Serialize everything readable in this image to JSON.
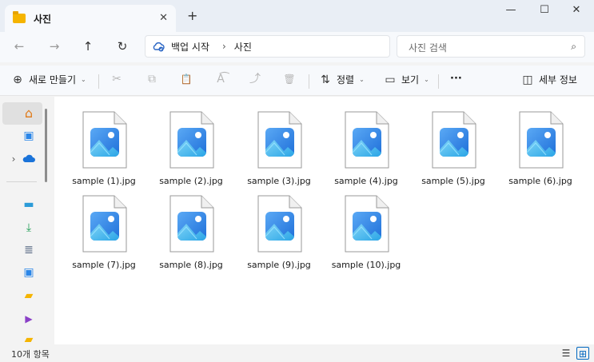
{
  "window": {
    "tab_title": "사진",
    "tab_close": "✕",
    "new_tab": "+",
    "minimize": "—",
    "maximize": "☐",
    "close": "✕"
  },
  "nav": {
    "back": "←",
    "forward": "→",
    "up": "↑",
    "refresh": "↻",
    "breadcrumb": [
      "백업 시작",
      "사진"
    ],
    "breadcrumb_sep": "›",
    "search_placeholder": "사진 검색",
    "search_icon": "⌕"
  },
  "commands": {
    "new": "새로 만들기",
    "sort": "정렬",
    "view": "보기",
    "more": "···",
    "details": "세부 정보",
    "dropdown": "⌄"
  },
  "icons": {
    "plus_circle": "⊕",
    "cut": "✂",
    "copy": "⧉",
    "paste": "📋",
    "rename": "A͡",
    "share": "⤴",
    "delete": "🗑",
    "sort": "⇅",
    "view": "▭",
    "details": "◫",
    "home": "⌂",
    "gallery": "▣",
    "expand": "›",
    "desktop": "▬",
    "downloads": "⤓",
    "documents": "≣",
    "pictures": "▣",
    "folder": "▰",
    "videos": "▶",
    "list_view": "☰",
    "grid_view": "⊞"
  },
  "files": [
    "sample (1).jpg",
    "sample (2).jpg",
    "sample (3).jpg",
    "sample (4).jpg",
    "sample (5).jpg",
    "sample (6).jpg",
    "sample (7).jpg",
    "sample (8).jpg",
    "sample (9).jpg",
    "sample (10).jpg"
  ],
  "status": {
    "item_count": "10개 항목"
  },
  "colors": {
    "accent": "#0067c0",
    "folder": "#f5b400",
    "photo_blue": "#2b86e8"
  }
}
